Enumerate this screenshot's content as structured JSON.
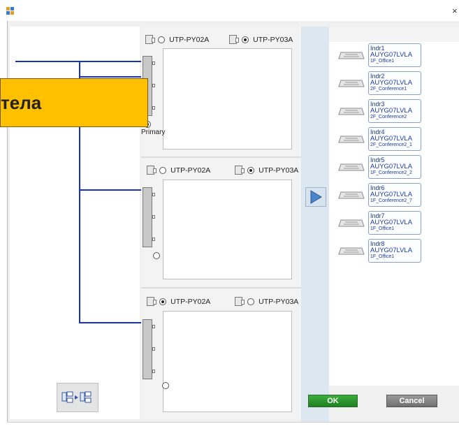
{
  "window": {
    "close_glyph": "×"
  },
  "callout": {
    "text": "тела"
  },
  "groups": [
    {
      "opt_a": "UTP-PY02A",
      "opt_b": "UTP-PY03A",
      "selected": "b",
      "primary_label": "Primary",
      "primary_selected": true
    },
    {
      "opt_a": "UTP-PY02A",
      "opt_b": "UTP-PY03A",
      "selected": "b",
      "primary_label": "",
      "primary_selected": false
    },
    {
      "opt_a": "UTP-PY02A",
      "opt_b": "UTP-PY03A",
      "selected": "a",
      "primary_label": "",
      "primary_selected": false
    }
  ],
  "units": [
    {
      "name": "Indr1",
      "model": "AUYG07LVLA",
      "room": "1F_Office1"
    },
    {
      "name": "Indr2",
      "model": "AUYG07LVLA",
      "room": "2F_Conference1"
    },
    {
      "name": "Indr3",
      "model": "AUYG07LVLA",
      "room": "2F_Conference2"
    },
    {
      "name": "Indr4",
      "model": "AUYG07LVLA",
      "room": "2F_Conference2_1"
    },
    {
      "name": "Indr5",
      "model": "AUYG07LVLA",
      "room": "1F_Conference2_2"
    },
    {
      "name": "Indr6",
      "model": "AUYG07LVLA",
      "room": "1F_Conference2_7"
    },
    {
      "name": "Indr7",
      "model": "AUYG07LVLA",
      "room": "1F_Office1"
    },
    {
      "name": "Indr8",
      "model": "AUYG07LVLA",
      "room": "1F_Office1"
    }
  ],
  "buttons": {
    "ok": "OK",
    "cancel": "Cancel"
  },
  "colors": {
    "pipe": "#1432c8",
    "callout": "#ffc000",
    "ok": "#2e9a2e"
  }
}
